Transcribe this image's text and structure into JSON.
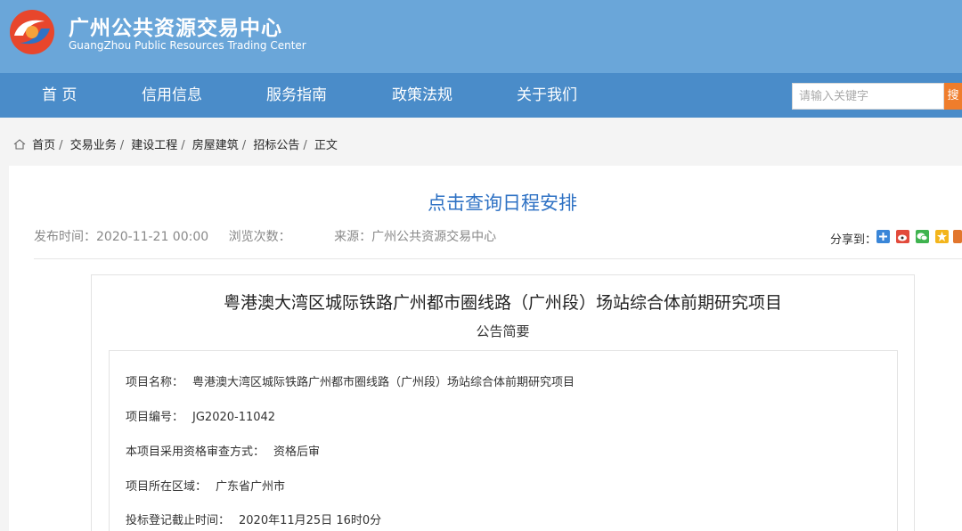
{
  "header": {
    "site_name": "广州公共资源交易中心",
    "site_name_en": "GuangZhou Public Resources Trading Center",
    "logo_icon": "logo-swirl-icon",
    "colors": {
      "header_bg": "#6aa6d9",
      "nav_bg": "#4a8cc9",
      "search_button": "#ef7d2c",
      "link": "#2f72c4"
    }
  },
  "nav": {
    "items": [
      {
        "label": "首 页"
      },
      {
        "label": "信用信息"
      },
      {
        "label": "服务指南"
      },
      {
        "label": "政策法规"
      },
      {
        "label": "关于我们"
      }
    ]
  },
  "search": {
    "placeholder": "请输入关键字",
    "button_label": "搜"
  },
  "breadcrumb": {
    "items": [
      "首页",
      "交易业务",
      "建设工程",
      "房屋建筑",
      "招标公告",
      "正文"
    ]
  },
  "article": {
    "schedule_link": "点击查询日程安排",
    "publish_time": "发布时间：2020-11-21 00:00",
    "views": "浏览次数：",
    "source": "来源：广州公共资源交易中心",
    "share_label": "分享到：",
    "share_icons": [
      "qzone-icon",
      "weibo-icon",
      "wechat-icon",
      "qq-icon",
      "renren-icon"
    ]
  },
  "notice": {
    "title": "粤港澳大湾区城际铁路广州都市圈线路（广州段）场站综合体前期研究项目",
    "subtitle": "公告简要",
    "fields": [
      {
        "label": "项目名称：",
        "value": "粤港澳大湾区城际铁路广州都市圈线路（广州段）场站综合体前期研究项目"
      },
      {
        "label": "项目编号：",
        "value": "JG2020-11042"
      },
      {
        "label": "本项目采用资格审查方式：",
        "value": "资格后审"
      },
      {
        "label": "项目所在区域：",
        "value": "广东省广州市"
      },
      {
        "label": "投标登记截止时间：",
        "value": "2020年11月25日 16时0分"
      }
    ]
  }
}
